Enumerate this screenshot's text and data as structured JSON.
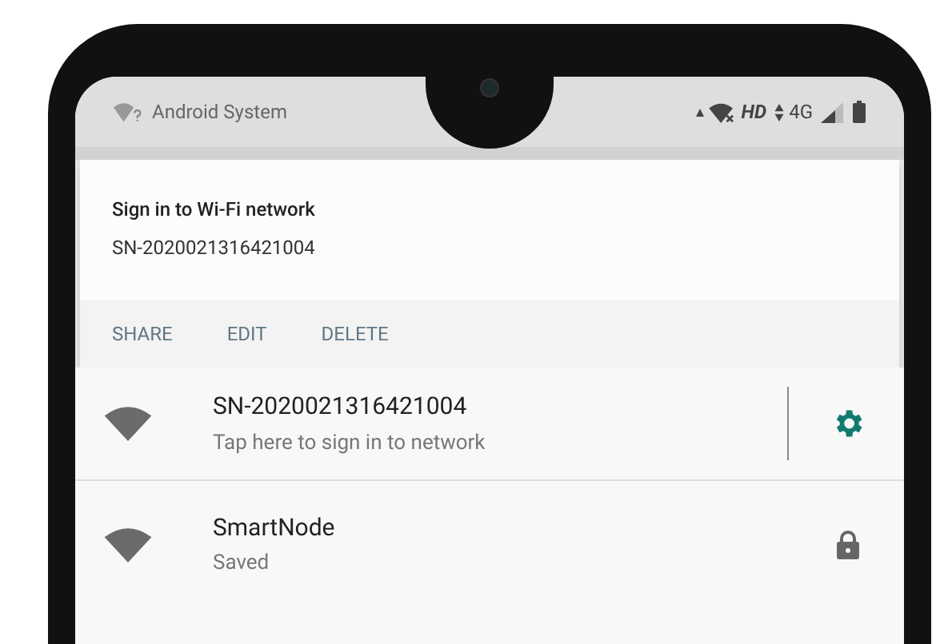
{
  "status_bar": {
    "app_name": "Android System",
    "network_label": "HD",
    "network_type": "4G"
  },
  "notification": {
    "title": "Sign in to Wi-Fi network",
    "text": "SN-2020021316421004",
    "actions": [
      "SHARE",
      "EDIT",
      "DELETE"
    ]
  },
  "networks": [
    {
      "name": "SN-2020021316421004",
      "status": "Tap here to sign in to network",
      "kind": "settings"
    },
    {
      "name": "SmartNode",
      "status": "Saved",
      "kind": "locked"
    }
  ]
}
